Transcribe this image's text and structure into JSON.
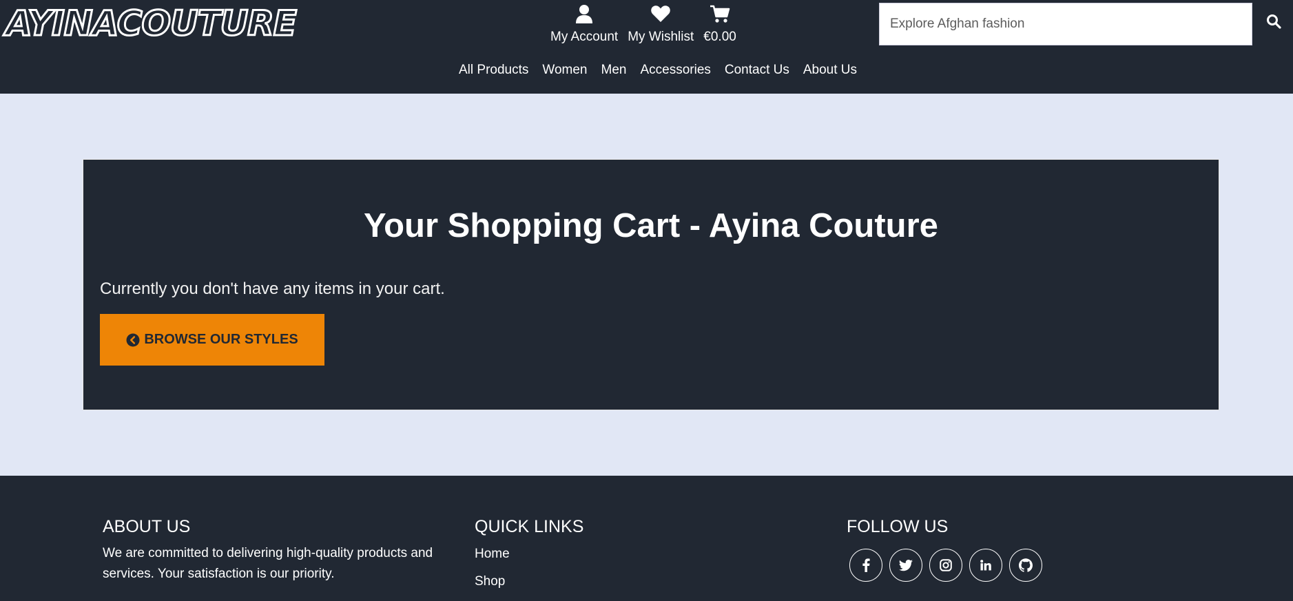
{
  "header": {
    "logo_text": "AYINACOUTURE",
    "account": [
      {
        "label": "My Account",
        "icon": "user-icon"
      },
      {
        "label": "My Wishlist",
        "icon": "heart-icon"
      },
      {
        "label": "€0.00",
        "icon": "cart-icon"
      }
    ],
    "search": {
      "placeholder": "Explore Afghan fashion",
      "value": ""
    },
    "nav": [
      "All Products",
      "Women",
      "Men",
      "Accessories",
      "Contact Us",
      "About Us"
    ]
  },
  "cart": {
    "title": "Your Shopping Cart - Ayina Couture",
    "message": "Currently you don't have any items in your cart.",
    "browse_label": "BROWSE OUR STYLES",
    "browse_icon": "chevron-circle-left-icon"
  },
  "footer": {
    "about_heading": "ABOUT US",
    "about_text": "We are committed to delivering high-quality products and services. Your satisfaction is our priority.",
    "links_heading": "QUICK LINKS",
    "links": [
      "Home",
      "Shop"
    ],
    "follow_heading": "FOLLOW US",
    "socials": [
      "facebook-icon",
      "twitter-icon",
      "instagram-icon",
      "linkedin-icon",
      "github-icon"
    ]
  },
  "colors": {
    "dark": "#212833",
    "page_bg": "#e1e7f5",
    "accent": "#ee8506"
  }
}
